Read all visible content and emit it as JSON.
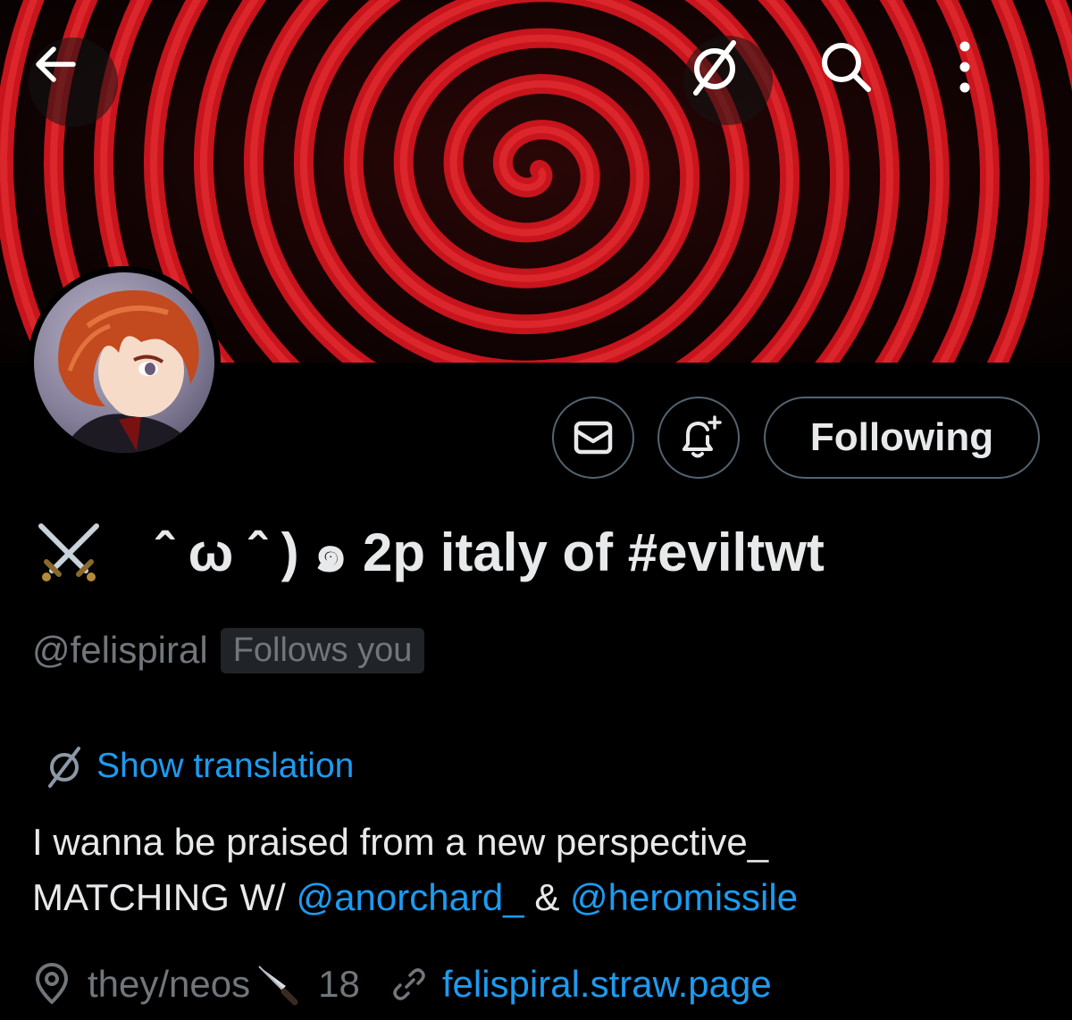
{
  "header": {
    "back_icon": "arrow-left-icon",
    "translate_icon": "translate-icon",
    "search_icon": "search-icon",
    "more_icon": "more-vertical-icon"
  },
  "profile": {
    "display_name_text": "ˆ ω ˆ ) ๑ 2p italy of #eviltwt",
    "handle": "@felispiral",
    "follows_you": "Follows you"
  },
  "actions": {
    "message_icon": "mail-icon",
    "notify_icon": "bell-plus-icon",
    "following_label": "Following"
  },
  "translation": {
    "link_label": "Show translation"
  },
  "bio": {
    "line1": "I wanna be praised from a new perspective_",
    "line2_prefix": "MATCHING W/ ",
    "mention1": "@anorchard_",
    "separator": " & ",
    "mention2": "@heromissile"
  },
  "meta": {
    "pronouns": "they/neos",
    "age": "18",
    "link": "felispiral.straw.page"
  },
  "colors": {
    "accent": "#1d9bf0",
    "text": "#e7e9ea",
    "muted": "#71767b",
    "background": "#000000",
    "banner_red": "#c8141c"
  }
}
